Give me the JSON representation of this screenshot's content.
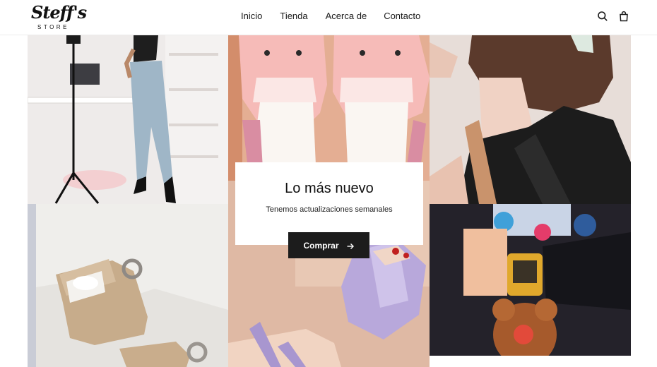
{
  "header": {
    "logo": {
      "script": "Steff's",
      "sub": "STORE"
    },
    "nav": [
      {
        "label": "Inicio"
      },
      {
        "label": "Tienda"
      },
      {
        "label": "Acerca de"
      },
      {
        "label": "Contacto"
      }
    ],
    "icons": [
      "search-icon",
      "bag-icon"
    ]
  },
  "hero": {
    "title": "Lo más nuevo",
    "subtitle": "Tenemos actualizaciones semanales",
    "cta_label": "Comprar",
    "cta_icon": "arrow-right-icon"
  },
  "colors": {
    "text": "#1a1a1a",
    "button_bg": "#1c1c1c",
    "button_text": "#ffffff",
    "background": "#ffffff"
  }
}
